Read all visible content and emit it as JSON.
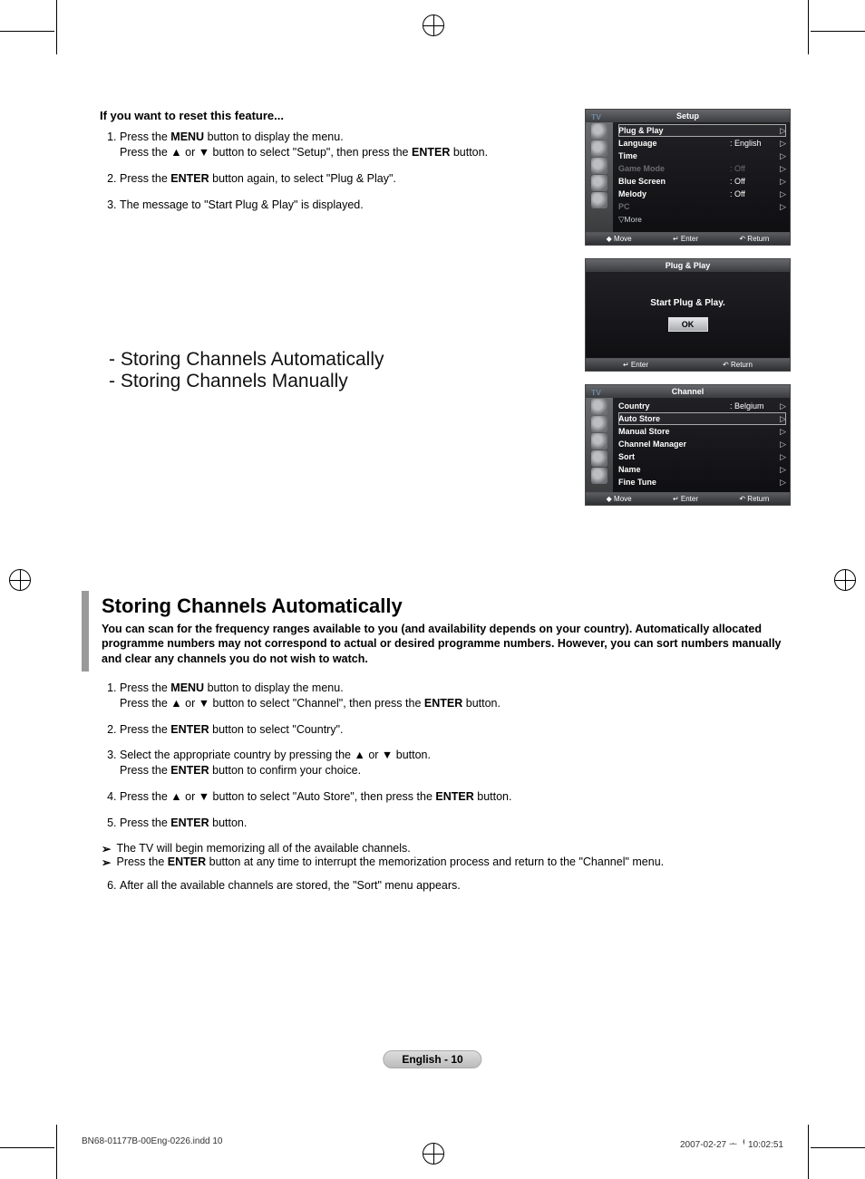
{
  "reset": {
    "heading": "If you want to reset this feature...",
    "s1a_pre": "Press the ",
    "s1a_menu": "MENU",
    "s1a_post": " button to display the menu.",
    "s1b_pre": "Press the ▲ or ▼ button to select \"Setup\", then press the ",
    "s1b_enter": "ENTER",
    "s1b_post": " button.",
    "s2_pre": "Press the ",
    "s2_enter": "ENTER",
    "s2_post": " button again, to select \"Plug & Play\".",
    "s3": "The message to \"Start Plug & Play\" is displayed."
  },
  "dash1": "- Storing Channels Automatically",
  "dash2": "- Storing Channels Manually",
  "osdSetup": {
    "tv": "TV",
    "title": "Setup",
    "rows": [
      {
        "label": "Plug & Play",
        "value": "",
        "sel": true,
        "dim": false,
        "arr": "▷"
      },
      {
        "label": "Language",
        "value": ": English",
        "sel": false,
        "dim": false,
        "arr": "▷"
      },
      {
        "label": "Time",
        "value": "",
        "sel": false,
        "dim": false,
        "arr": "▷"
      },
      {
        "label": "Game Mode",
        "value": ": Off",
        "sel": false,
        "dim": true,
        "arr": "▷"
      },
      {
        "label": "Blue Screen",
        "value": ": Off",
        "sel": false,
        "dim": false,
        "arr": "▷"
      },
      {
        "label": "Melody",
        "value": ": Off",
        "sel": false,
        "dim": false,
        "arr": "▷"
      },
      {
        "label": "PC",
        "value": "",
        "sel": false,
        "dim": true,
        "arr": "▷"
      }
    ],
    "more": "▽More",
    "foot": {
      "move": "◆ Move",
      "enter": "↵ Enter",
      "return": "↶ Return"
    }
  },
  "osdDialog": {
    "title": "Plug & Play",
    "msg": "Start Plug & Play.",
    "ok": "OK",
    "foot": {
      "enter": "↵ Enter",
      "return": "↶  Return"
    }
  },
  "osdChannel": {
    "tv": "TV",
    "title": "Channel",
    "rows": [
      {
        "label": "Country",
        "value": ": Belgium",
        "sel": false,
        "dim": false,
        "arr": "▷"
      },
      {
        "label": "Auto Store",
        "value": "",
        "sel": true,
        "dim": false,
        "arr": "▷"
      },
      {
        "label": "Manual Store",
        "value": "",
        "sel": false,
        "dim": false,
        "arr": "▷"
      },
      {
        "label": "Channel Manager",
        "value": "",
        "sel": false,
        "dim": false,
        "arr": "▷"
      },
      {
        "label": "Sort",
        "value": "",
        "sel": false,
        "dim": false,
        "arr": "▷"
      },
      {
        "label": "Name",
        "value": "",
        "sel": false,
        "dim": false,
        "arr": "▷"
      },
      {
        "label": "Fine Tune",
        "value": "",
        "sel": false,
        "dim": false,
        "arr": "▷"
      }
    ],
    "foot": {
      "move": "◆ Move",
      "enter": "↵ Enter",
      "return": "↶ Return"
    }
  },
  "section": {
    "title": "Storing Channels Automatically",
    "desc": "You can scan for the frequency ranges available to you (and availability depends on your country). Automatically allocated programme numbers may not correspond to actual or desired programme numbers. However, you can sort numbers manually and clear any channels you do not wish to watch.",
    "s1a_pre": "Press the ",
    "s1a_menu": "MENU",
    "s1a_post": " button to display the menu.",
    "s1b_pre": "Press the ▲ or ▼ button to select \"Channel\", then press the ",
    "s1b_enter": "ENTER",
    "s1b_post": " button.",
    "s2_pre": "Press the ",
    "s2_enter": "ENTER",
    "s2_post": " button to select \"Country\".",
    "s3a": "Select the appropriate country by pressing the ▲ or ▼ button.",
    "s3b_pre": "Press the ",
    "s3b_enter": "ENTER",
    "s3b_post": " button to confirm your choice.",
    "s4_pre": "Press the ▲ or ▼ button to select \"Auto Store\", then press the ",
    "s4_enter": "ENTER",
    "s4_post": " button.",
    "s5_pre": " Press the ",
    "s5_enter": "ENTER",
    "s5_post": " button.",
    "note1": "The TV will begin memorizing all of the available channels.",
    "note2_pre": "Press the ",
    "note2_enter": "ENTER",
    "note2_post": " button at any time to interrupt the memorization process and return to the \"Channel\" menu.",
    "s6": "After all the available channels are stored, the \"Sort\" menu appears."
  },
  "pagePill": "English - 10",
  "footerLeft": "BN68-01177B-00Eng-0226.indd   10",
  "footerRight": "2007-02-27   ᅩᅥ 10:02:51",
  "noteArrow": "➢"
}
